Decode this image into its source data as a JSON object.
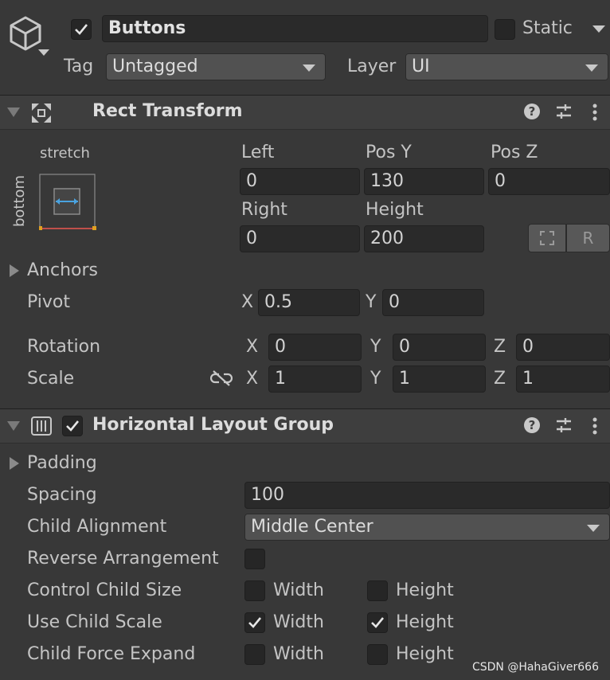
{
  "object": {
    "active": true,
    "name": "Buttons",
    "static_label": "Static",
    "static_checked": false,
    "tag_label": "Tag",
    "tag_value": "Untagged",
    "layer_label": "Layer",
    "layer_value": "UI"
  },
  "rect_transform": {
    "title": "Rect Transform",
    "anchor_preset_h": "stretch",
    "anchor_preset_v": "bottom",
    "labels": {
      "left": "Left",
      "pos_y": "Pos Y",
      "pos_z": "Pos Z",
      "right": "Right",
      "height": "Height"
    },
    "values": {
      "left": "0",
      "pos_y": "130",
      "pos_z": "0",
      "right": "0",
      "height": "200"
    },
    "blueprint_button": "⬚",
    "raw_button": "R",
    "anchors_label": "Anchors",
    "pivot": {
      "label": "Pivot",
      "x_label": "X",
      "x": "0.5",
      "y_label": "Y",
      "y": "0"
    },
    "rotation": {
      "label": "Rotation",
      "x_label": "X",
      "x": "0",
      "y_label": "Y",
      "y": "0",
      "z_label": "Z",
      "z": "0"
    },
    "scale": {
      "label": "Scale",
      "x_label": "X",
      "x": "1",
      "y_label": "Y",
      "y": "1",
      "z_label": "Z",
      "z": "1"
    }
  },
  "hlg": {
    "title": "Horizontal Layout Group",
    "enabled": true,
    "padding_label": "Padding",
    "spacing_label": "Spacing",
    "spacing_value": "100",
    "child_alignment_label": "Child Alignment",
    "child_alignment_value": "Middle Center",
    "reverse_label": "Reverse Arrangement",
    "reverse_checked": false,
    "control_child_size": {
      "label": "Control Child Size",
      "width_label": "Width",
      "height_label": "Height",
      "width": false,
      "height": false
    },
    "use_child_scale": {
      "label": "Use Child Scale",
      "width_label": "Width",
      "height_label": "Height",
      "width": true,
      "height": true
    },
    "child_force_expand": {
      "label": "Child Force Expand",
      "width_label": "Width",
      "height_label": "Height",
      "width": false,
      "height": false
    }
  },
  "watermark": "CSDN @HahaGiver666",
  "colors": {
    "background": "#383838",
    "field": "#2a2a2a",
    "header": "#3e3e3e",
    "anchor_blue": "#4aa3e0",
    "anchor_red": "#c0504a",
    "anchor_handle": "#e0a020"
  }
}
